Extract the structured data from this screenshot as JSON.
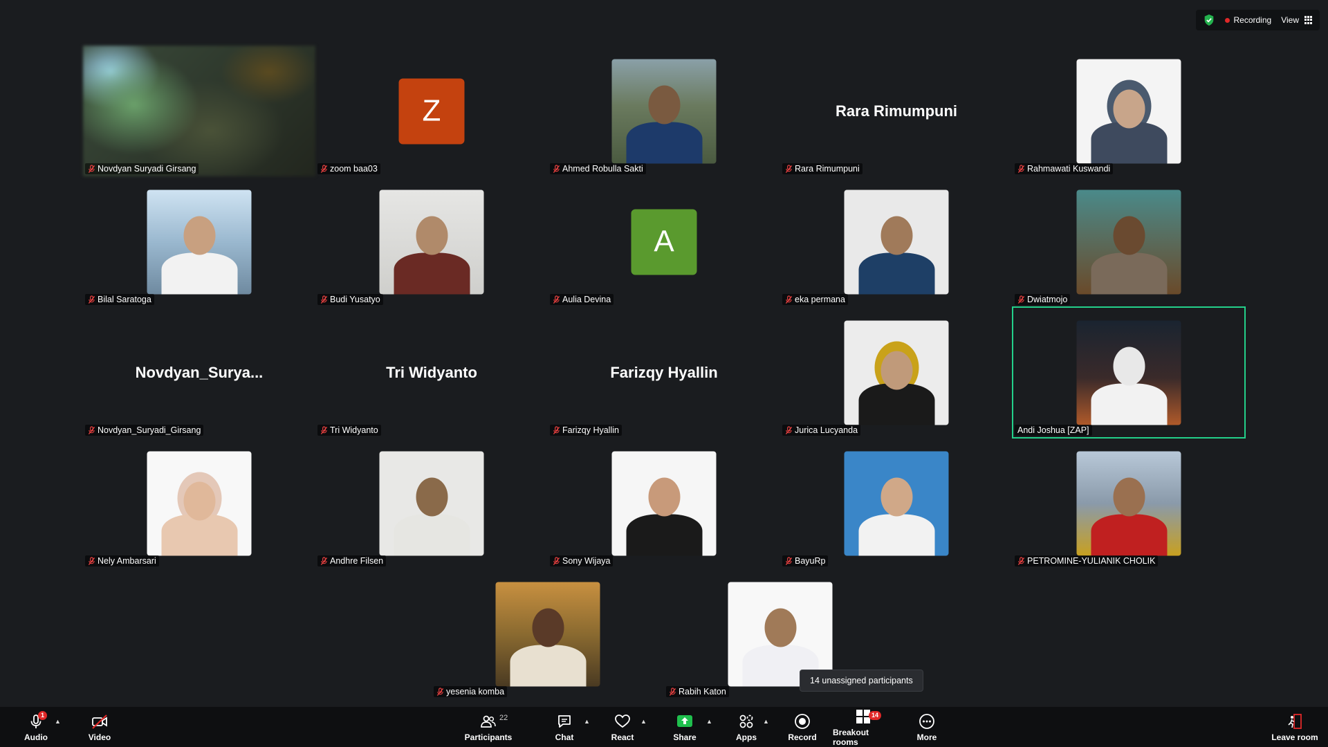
{
  "top_bar": {
    "recording_label": "Recording",
    "view_label": "View"
  },
  "tiles": [
    {
      "name": "Novdyan Suryadi Girsang",
      "type": "video"
    },
    {
      "name": "zoom baa03",
      "type": "avatar",
      "initial": "Z",
      "color": "#c4420f"
    },
    {
      "name": "Ahmed Robulla Sakti",
      "type": "photo"
    },
    {
      "name": "Rara Rimumpuni",
      "type": "name",
      "display_name": "Rara Rimumpuni"
    },
    {
      "name": "Rahmawati Kuswandi",
      "type": "photo"
    },
    {
      "name": "Bilal Saratoga",
      "type": "photo"
    },
    {
      "name": "Budi Yusatyo",
      "type": "photo"
    },
    {
      "name": "Aulia Devina",
      "type": "avatar",
      "initial": "A",
      "color": "#5a9a2e"
    },
    {
      "name": "eka permana",
      "type": "photo"
    },
    {
      "name": "Dwiatmojo",
      "type": "photo"
    },
    {
      "name": "Novdyan_Suryadi_Girsang",
      "type": "name",
      "display_name": "Novdyan_Surya..."
    },
    {
      "name": "Tri Widyanto",
      "type": "name",
      "display_name": "Tri Widyanto"
    },
    {
      "name": "Farizqy Hyallin",
      "type": "name",
      "display_name": "Farizqy Hyallin"
    },
    {
      "name": "Jurica Lucyanda",
      "type": "photo"
    },
    {
      "name": "Andi Joshua [ZAP]",
      "type": "photo",
      "active": true
    },
    {
      "name": "Nely Ambarsari",
      "type": "photo"
    },
    {
      "name": "Andhre Filsen",
      "type": "photo"
    },
    {
      "name": "Sony Wijaya",
      "type": "photo"
    },
    {
      "name": "BayuRp",
      "type": "photo"
    },
    {
      "name": "PETROMINE-YULIANIK CHOLIK",
      "type": "photo"
    },
    {
      "name": "yesenia komba",
      "type": "photo"
    },
    {
      "name": "Rabih Katon",
      "type": "photo"
    }
  ],
  "tooltip": "14 unassigned participants",
  "toolbar": {
    "audio": "Audio",
    "video": "Video",
    "participants": "Participants",
    "participants_count": "22",
    "chat": "Chat",
    "react": "React",
    "share": "Share",
    "apps": "Apps",
    "record": "Record",
    "breakout": "Breakout rooms",
    "breakout_badge": "14",
    "more": "More",
    "leave": "Leave room",
    "audio_badge": "1"
  },
  "colors": {
    "active_speaker": "#23d18b",
    "share_green": "#1fbf4d",
    "badge_red": "#e02828"
  }
}
